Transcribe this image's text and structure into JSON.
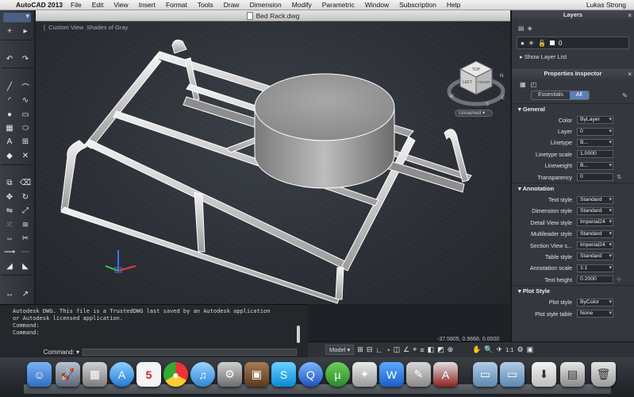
{
  "menubar": {
    "app_name": "AutoCAD 2013",
    "items": [
      "File",
      "Edit",
      "View",
      "Insert",
      "Format",
      "Tools",
      "Draw",
      "Dimension",
      "Modify",
      "Parametric",
      "Window",
      "Subscription",
      "Help"
    ],
    "user": "Lukas Strong"
  },
  "drawing": {
    "title": "Bed Rack.dwg",
    "view_controls": [
      "[",
      "Custom View",
      "Shades of Gray"
    ],
    "viewcube_dropdown": "Unnamed",
    "viewcube_labels": {
      "top": "TOP",
      "front": "FRONT",
      "left": "LEFT"
    },
    "compass": {
      "n": "N",
      "s": "S",
      "e": "E",
      "w": "W"
    }
  },
  "command": {
    "lines": [
      "Autodesk DWG.  This file is a TrustedDWG last saved by an Autodesk application",
      "or Autodesk licensed application.",
      "Command:",
      "Command:"
    ],
    "prompt": "Command:"
  },
  "status": {
    "coords": "-37.5805, 0.9668, 0.0000",
    "model_label": "Model",
    "scale": "1:1"
  },
  "layers_palette": {
    "title": "Layers",
    "current_layer": "0",
    "show_layer_list": "Show Layer List"
  },
  "properties": {
    "title": "Properties Inspector",
    "tabs": {
      "essentials": "Essentials",
      "all": "All"
    },
    "general": {
      "heading": "General",
      "rows": [
        {
          "label": "Color",
          "value": "ByLayer"
        },
        {
          "label": "Layer",
          "value": "0"
        },
        {
          "label": "Linetype",
          "value": "B..."
        },
        {
          "label": "Linetype scale",
          "value": "1.0000"
        },
        {
          "label": "Lineweight",
          "value": "B..."
        },
        {
          "label": "Transparency",
          "value": "0"
        }
      ]
    },
    "annotation": {
      "heading": "Annotation",
      "rows": [
        {
          "label": "Text style",
          "value": "Standard"
        },
        {
          "label": "Dimension style",
          "value": "Standard"
        },
        {
          "label": "Detail View style",
          "value": "Imperial24"
        },
        {
          "label": "Multileader style",
          "value": "Standard"
        },
        {
          "label": "Section View s...",
          "value": "Imperial24"
        },
        {
          "label": "Table style",
          "value": "Standard"
        },
        {
          "label": "Annotation scale",
          "value": "1:1"
        },
        {
          "label": "Text height",
          "value": "0.2000"
        }
      ]
    },
    "plot_style": {
      "heading": "Plot Style",
      "rows": [
        {
          "label": "Plot style",
          "value": "ByColor"
        },
        {
          "label": "Plot style table",
          "value": "None"
        }
      ]
    }
  },
  "dock": {
    "calendar_day": "5"
  }
}
